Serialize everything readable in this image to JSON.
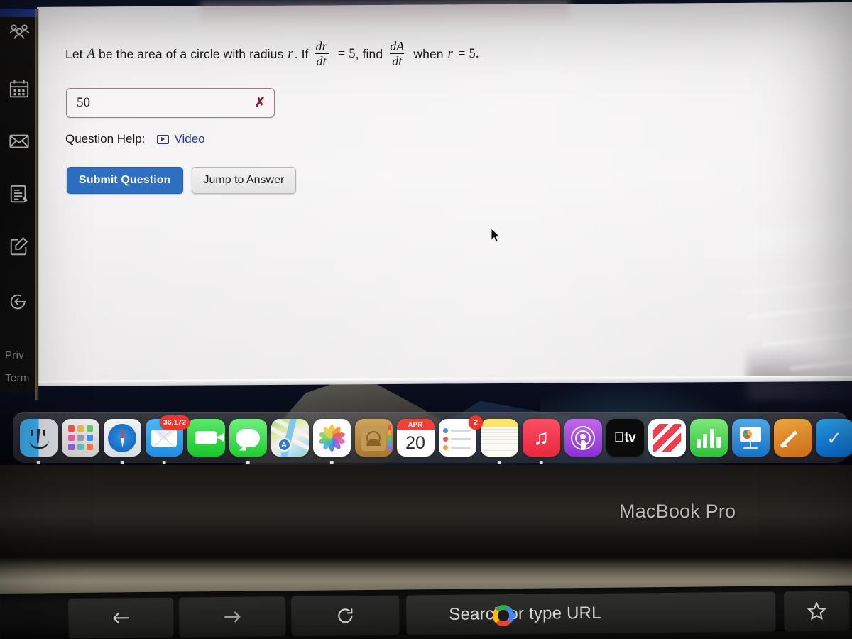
{
  "device": {
    "brand_label": "MacBook Pro"
  },
  "question": {
    "prompt_part1": "Let",
    "var_A": "A",
    "prompt_part2": "be the area of a circle with radius",
    "var_r": "r",
    "prompt_if": ". If",
    "frac1_num": "dr",
    "frac1_den": "dt",
    "equals": "=",
    "value1": "5",
    "prompt_find": ", find",
    "frac2_num": "dA",
    "frac2_den": "dt",
    "prompt_when": "when",
    "var_r2": "r",
    "equals2": "=",
    "value2": "5",
    "period": "."
  },
  "answer": {
    "value": "50",
    "mark": "✗",
    "mark_meaning": "incorrect"
  },
  "help": {
    "label": "Question Help:",
    "video_link": "Video",
    "video_icon": "play-video-icon"
  },
  "buttons": {
    "submit": "Submit Question",
    "jump": "Jump to Answer"
  },
  "sidebar": {
    "items": [
      {
        "icon": "people-group-icon",
        "name": "people"
      },
      {
        "icon": "calendar-icon",
        "name": "calendar"
      },
      {
        "icon": "mail-envelope-icon",
        "name": "mail"
      },
      {
        "icon": "document-notes-icon",
        "name": "notes"
      },
      {
        "icon": "compose-edit-icon",
        "name": "compose"
      },
      {
        "icon": "back-arrow-circle-icon",
        "name": "back"
      }
    ],
    "footer_links": [
      {
        "label": "Priv"
      },
      {
        "label": "Term"
      }
    ]
  },
  "dock": {
    "items": [
      {
        "name": "Finder",
        "icon": "finder-icon",
        "badge": null,
        "running": true
      },
      {
        "name": "Launchpad",
        "icon": "launchpad-icon",
        "badge": null,
        "running": false
      },
      {
        "name": "Safari",
        "icon": "safari-icon",
        "badge": null,
        "running": true
      },
      {
        "name": "Mail",
        "icon": "mail-icon",
        "badge": "36,172",
        "running": true
      },
      {
        "name": "FaceTime",
        "icon": "facetime-icon",
        "badge": null,
        "running": false
      },
      {
        "name": "Messages",
        "icon": "messages-icon",
        "badge": null,
        "running": true
      },
      {
        "name": "Maps",
        "icon": "maps-icon",
        "badge": null,
        "running": false
      },
      {
        "name": "Photos",
        "icon": "photos-icon",
        "badge": null,
        "running": true
      },
      {
        "name": "Contacts",
        "icon": "contacts-icon",
        "badge": null,
        "running": false
      },
      {
        "name": "Calendar",
        "icon": "calendar-icon",
        "badge": null,
        "running": false,
        "month": "APR",
        "day": "20"
      },
      {
        "name": "Reminders",
        "icon": "reminders-icon",
        "badge": "2",
        "running": false
      },
      {
        "name": "Notes",
        "icon": "notes-icon",
        "badge": null,
        "running": true
      },
      {
        "name": "Music",
        "icon": "music-icon",
        "badge": null,
        "running": true
      },
      {
        "name": "Podcasts",
        "icon": "podcasts-icon",
        "badge": null,
        "running": false
      },
      {
        "name": "Apple TV",
        "icon": "appletv-icon",
        "badge": null,
        "running": false,
        "label": "tv"
      },
      {
        "name": "News",
        "icon": "news-icon",
        "badge": null,
        "running": false
      },
      {
        "name": "Numbers",
        "icon": "numbers-icon",
        "badge": null,
        "running": false
      },
      {
        "name": "Keynote",
        "icon": "keynote-icon",
        "badge": null,
        "running": false
      },
      {
        "name": "Pages",
        "icon": "pages-icon",
        "badge": null,
        "running": false
      },
      {
        "name": "App Store",
        "icon": "appstore-icon",
        "badge": null,
        "running": false
      }
    ]
  },
  "touchbar": {
    "back_icon": "back-arrow-icon",
    "forward_icon": "forward-arrow-icon",
    "reload_icon": "reload-icon",
    "url_placeholder": "Search or type URL",
    "search_engine_icon": "google-g-icon",
    "bookmark_icon": "star-icon"
  },
  "colors": {
    "submit_button": "#2f6fc0",
    "link": "#2b3a8f",
    "incorrect_mark": "#8d1f2d",
    "answer_border": "#9c7d84",
    "badge_red": "#f4342a"
  }
}
